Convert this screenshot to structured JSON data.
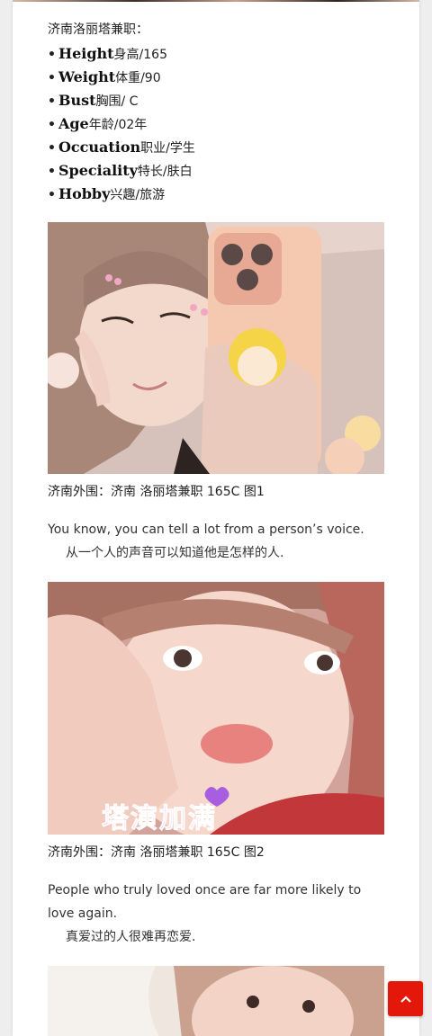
{
  "post": {
    "intro": "济南洛丽塔兼职：",
    "attributes": [
      {
        "bullet": "•",
        "key": "Height",
        "value": "身高/165"
      },
      {
        "bullet": "•",
        "key": "Weight",
        "value": "体重/90"
      },
      {
        "bullet": "•",
        "key": "Bust",
        "value": "胸围/ C"
      },
      {
        "bullet": "•",
        "key": "Age",
        "value": "年龄/02年"
      },
      {
        "bullet": "•",
        "key": "Occuation",
        "value": "职业/学生"
      },
      {
        "bullet": "•",
        "key": "Speciality",
        "value": "特长/肤白"
      },
      {
        "bullet": "•",
        "key": "Hobby",
        "value": "兴趣/旅游"
      }
    ],
    "photos": [
      {
        "caption": "济南外围：济南 洛丽塔兼职 165C 图1",
        "quote_en": "You know, you can tell a lot from a person’s voice.",
        "quote_zh": "从一个人的声音可以知道他是怎样的人."
      },
      {
        "caption": "济南外围：济南 洛丽塔兼职 165C 图2",
        "quote_en": "People who truly loved once are far more likely to love again.",
        "quote_zh": "真爱过的人很难再恋爱.",
        "sticker_text": "塔演加满"
      }
    ]
  },
  "ui": {
    "scroll_top_icon": "chevron-up-icon",
    "accent_color": "#e3170a"
  }
}
